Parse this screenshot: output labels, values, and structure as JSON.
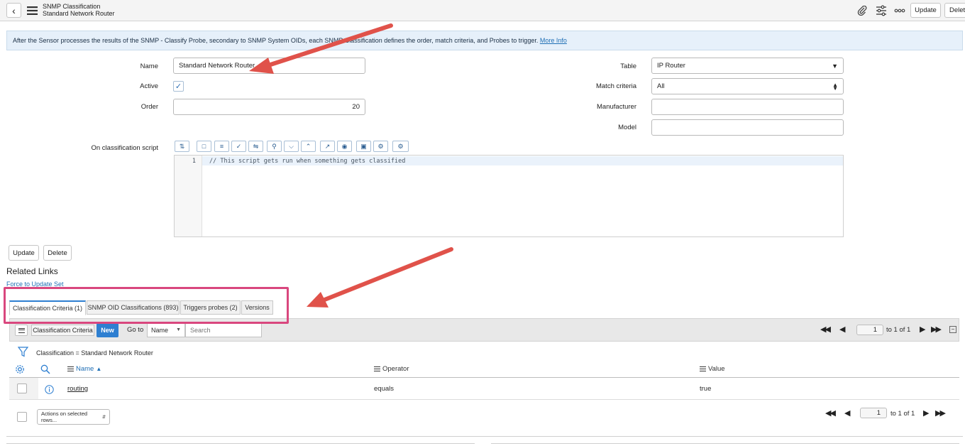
{
  "header": {
    "title": "SNMP Classification",
    "subtitle": "Standard Network Router",
    "update_label": "Update",
    "delete_label": "Delete"
  },
  "info": {
    "text": "After the Sensor processes the results of the SNMP - Classify Probe, secondary to SNMP System OIDs, each SNMP Classification defines the order, match criteria, and Probes to trigger.",
    "link": "More Info"
  },
  "form": {
    "name_label": "Name",
    "name_value": "Standard Network Router",
    "active_label": "Active",
    "active_checked": "✓",
    "order_label": "Order",
    "order_value": "20",
    "table_label": "Table",
    "table_value": "IP Router",
    "match_label": "Match criteria",
    "match_value": "All",
    "manufacturer_label": "Manufacturer",
    "manufacturer_value": "",
    "model_label": "Model",
    "model_value": "",
    "script_label": "On classification script",
    "line_number": "1",
    "script_code": "// This script gets run when something gets classified"
  },
  "buttons": {
    "update": "Update",
    "delete": "Delete"
  },
  "related": {
    "title": "Related Links",
    "link": "Force to Update Set"
  },
  "tabs": [
    {
      "label": "Classification Criteria (1)"
    },
    {
      "label": "SNMP OID Classifications (893)"
    },
    {
      "label": "Triggers probes (2)"
    },
    {
      "label": "Versions"
    }
  ],
  "list": {
    "title": "Classification Criteria",
    "new_label": "New",
    "goto_label": "Go to",
    "goto_field": "Name",
    "search_placeholder": "Search",
    "page_value": "1",
    "page_text": "to 1 of 1",
    "filter_text": "Classification = Standard Network Router",
    "columns": {
      "name": "Name",
      "operator": "Operator",
      "value": "Value"
    },
    "rows": [
      {
        "name": "routing",
        "operator": "equals",
        "value": "true"
      }
    ],
    "actions_label": "Actions on selected rows..."
  },
  "colors": {
    "accent": "#2e7fd1",
    "annotation_arrow": "#e0524a",
    "annotation_box": "#d9477e"
  }
}
